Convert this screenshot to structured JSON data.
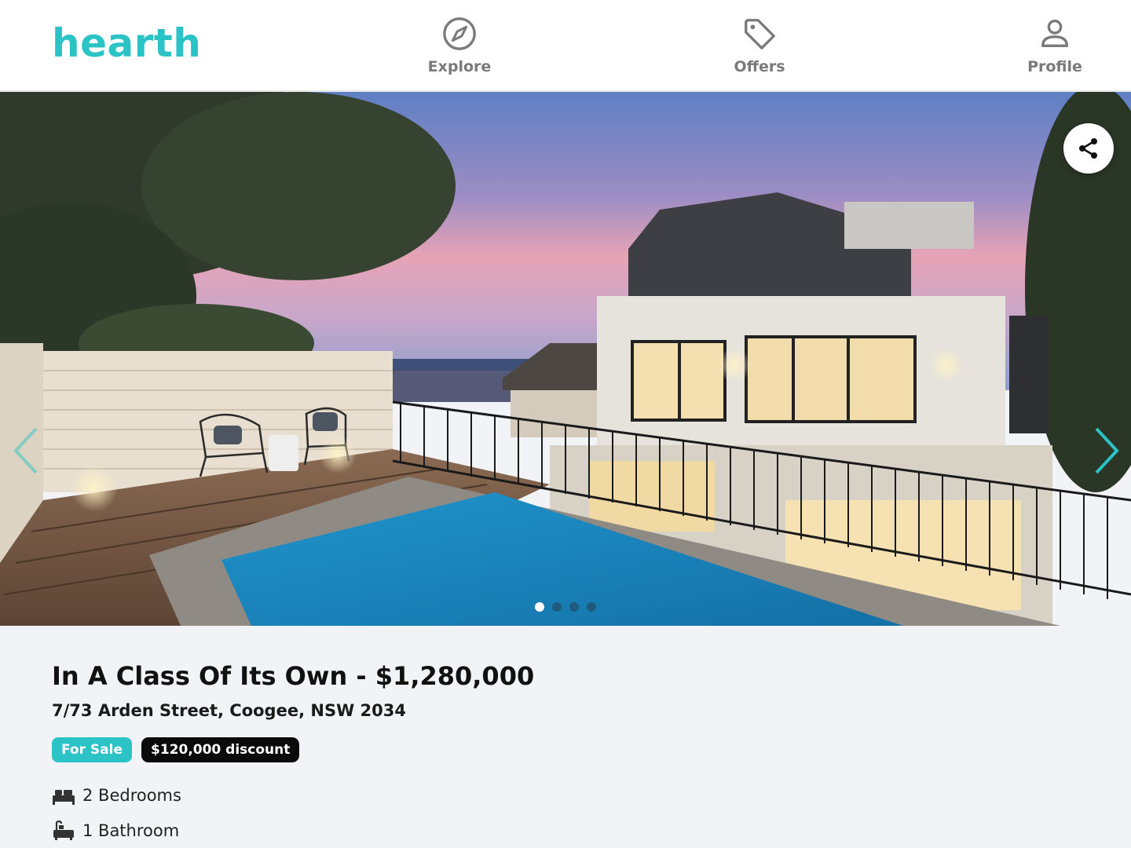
{
  "header": {
    "logo": "hearth",
    "nav": [
      {
        "label": "Explore",
        "icon": "compass-icon"
      },
      {
        "label": "Offers",
        "icon": "tag-icon"
      },
      {
        "label": "Profile",
        "icon": "user-icon"
      }
    ]
  },
  "gallery": {
    "image": "house-with-pool-at-sunset",
    "slide_count": 4,
    "active_slide": 1,
    "share_icon": "share-icon",
    "prev_icon": "chevron-left-icon",
    "next_icon": "chevron-right-icon"
  },
  "listing": {
    "title": "In A Class Of Its Own - $1,280,000",
    "address": "7/73 Arden Street, Coogee, NSW 2034",
    "badges": {
      "status": "For Sale",
      "discount": "$120,000 discount"
    },
    "features": {
      "bedrooms": "2 Bedrooms",
      "bathrooms": "1 Bathroom"
    }
  },
  "colors": {
    "accent": "#2cc3c6",
    "badge_dark": "#0b0b0b",
    "background": "#f2f3f7"
  }
}
